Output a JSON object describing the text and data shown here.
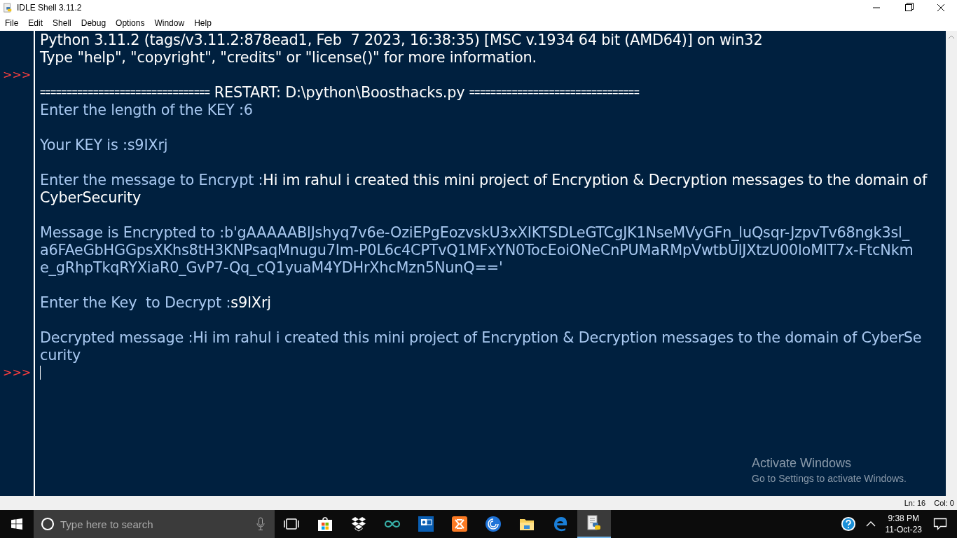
{
  "window": {
    "title": "IDLE Shell 3.11.2"
  },
  "menu": [
    "File",
    "Edit",
    "Shell",
    "Debug",
    "Options",
    "Window",
    "Help"
  ],
  "shell": {
    "lines": [
      {
        "kind": "text",
        "parts": [
          {
            "kind": "output",
            "text": "Python 3.11.2 (tags/v3.11.2:878ead1, Feb  7 2023, 16:38:35) [MSC v.1934 64 bit (AMD64)] on win32"
          }
        ]
      },
      {
        "kind": "text",
        "parts": [
          {
            "kind": "output",
            "text": "Type \"help\", \"copyright\", \"credits\" or \"license()\" for more information."
          }
        ]
      },
      {
        "kind": "blank",
        "prompt": ">>>"
      },
      {
        "kind": "text",
        "parts": [
          {
            "kind": "rule",
            "text": "================================"
          },
          {
            "kind": "output",
            "text": " RESTART: D:\\python\\Boosthacks.py "
          },
          {
            "kind": "rule",
            "text": "================================"
          }
        ]
      },
      {
        "kind": "text",
        "parts": [
          {
            "kind": "stdout",
            "text": "Enter the length of the KEY :6"
          }
        ]
      },
      {
        "kind": "blank"
      },
      {
        "kind": "text",
        "parts": [
          {
            "kind": "stdout",
            "text": "Your KEY is :s9IXrj"
          }
        ]
      },
      {
        "kind": "blank"
      },
      {
        "kind": "text",
        "parts": [
          {
            "kind": "stdout",
            "text": "Enter the message to Encrypt :"
          },
          {
            "kind": "input",
            "text": "Hi im rahul i created this mini project of Encryption & Decryption messages to the domain of"
          }
        ]
      },
      {
        "kind": "text",
        "parts": [
          {
            "kind": "input",
            "text": "CyberSecurity"
          }
        ]
      },
      {
        "kind": "blank"
      },
      {
        "kind": "text",
        "parts": [
          {
            "kind": "stdout",
            "text": "Message is Encrypted to :b'gAAAAABlJshyq7v6e-OziEPgEozvskU3xXIKTSDLeGTCgJK1NseMVyGFn_luQsqr-JzpvTv68ngk3sl_"
          }
        ]
      },
      {
        "kind": "text",
        "parts": [
          {
            "kind": "stdout",
            "text": "a6FAeGbHGGpsXKhs8tH3KNPsaqMnugu7Im-P0L6c4CPTvQ1MFxYN0TocEoiONeCnPUMaRMpVwtbUlJXtzU00loMlT7x-FtcNkm"
          }
        ]
      },
      {
        "kind": "text",
        "parts": [
          {
            "kind": "stdout",
            "text": "e_gRhpTkqRYXiaR0_GvP7-Qq_cQ1yuaM4YDHrXhcMzn5NunQ=='"
          }
        ]
      },
      {
        "kind": "blank"
      },
      {
        "kind": "text",
        "parts": [
          {
            "kind": "stdout",
            "text": "Enter the Key  to Decrypt :"
          },
          {
            "kind": "input",
            "text": "s9IXrj"
          }
        ]
      },
      {
        "kind": "blank"
      },
      {
        "kind": "text",
        "parts": [
          {
            "kind": "stdout",
            "text": "Decrypted message :Hi im rahul i created this mini project of Encryption & Decryption messages to the domain of CyberSe"
          }
        ]
      },
      {
        "kind": "text",
        "parts": [
          {
            "kind": "stdout",
            "text": "curity"
          }
        ]
      },
      {
        "kind": "blank",
        "prompt": ">>>",
        "cursor": true
      }
    ]
  },
  "activation": {
    "title": "Activate Windows",
    "subtitle": "Go to Settings to activate Windows."
  },
  "status_bar": {
    "line": "Ln: 16",
    "column": "Col: 0"
  },
  "taskbar": {
    "search_placeholder": "Type here to search",
    "apps": [
      {
        "kind": "taskview",
        "selected": false
      },
      {
        "kind": "store",
        "selected": false
      },
      {
        "kind": "dropbox",
        "selected": false
      },
      {
        "kind": "infinity",
        "selected": false
      },
      {
        "kind": "outlook",
        "selected": false
      },
      {
        "kind": "xampp",
        "selected": false
      },
      {
        "kind": "swirl",
        "selected": false
      },
      {
        "kind": "folder",
        "selected": false
      },
      {
        "kind": "edge",
        "selected": false
      },
      {
        "kind": "python",
        "selected": true
      }
    ],
    "time": "9:38 PM",
    "date": "11-Oct-23"
  }
}
